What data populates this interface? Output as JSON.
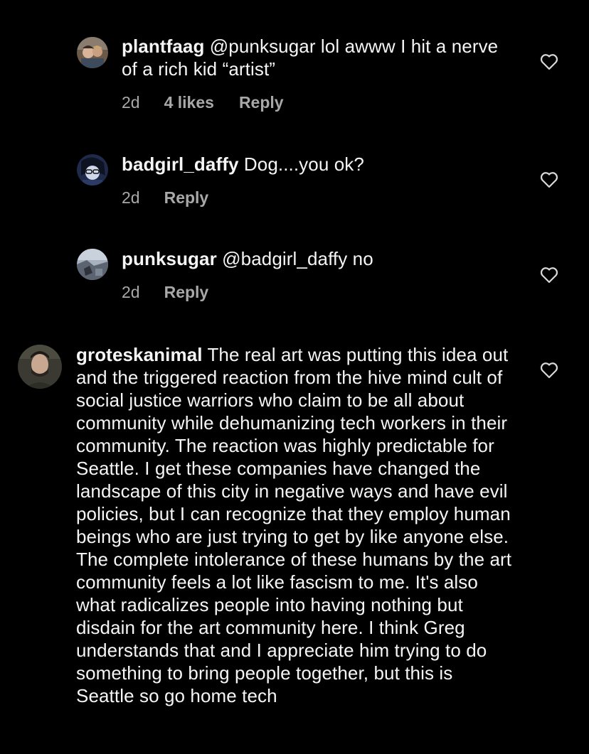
{
  "comments": [
    {
      "username": "plantfaag",
      "text": "@punksugar lol awww I hit a nerve of a rich kid “artist”",
      "time": "2d",
      "likes": "4 likes",
      "reply": "Reply",
      "avatar_icon": "user-avatar-photo",
      "like_icon": "heart-outline-icon"
    },
    {
      "username": "badgirl_daffy",
      "text": "Dog....you ok?",
      "time": "2d",
      "reply": "Reply",
      "avatar_icon": "user-avatar-photo",
      "like_icon": "heart-outline-icon"
    },
    {
      "username": "punksugar",
      "text": "@badgirl_daffy no",
      "time": "2d",
      "reply": "Reply",
      "avatar_icon": "user-avatar-photo",
      "like_icon": "heart-outline-icon"
    },
    {
      "username": "groteskanimal",
      "text": "The real art was putting this idea out and the triggered reaction from the hive mind cult of social justice warriors who claim to be all about community while dehumanizing tech workers in their community. The reaction was highly predictable for Seattle. I get these companies have changed the landscape of this city in negative ways and have evil policies, but I can recognize that they employ human beings who are just trying to get by like anyone else. The complete intolerance of these humans by the art community feels a lot like fascism to me. It's also what radicalizes people into having nothing but disdain for the art community here. I think Greg understands that and I appreciate him trying to do something to bring people together, but this is Seattle so go home tech",
      "avatar_icon": "user-avatar-photo",
      "like_icon": "heart-outline-icon"
    }
  ],
  "colors": {
    "background": "#000000",
    "text": "#f5f5f5",
    "meta": "#a8a8a8"
  }
}
